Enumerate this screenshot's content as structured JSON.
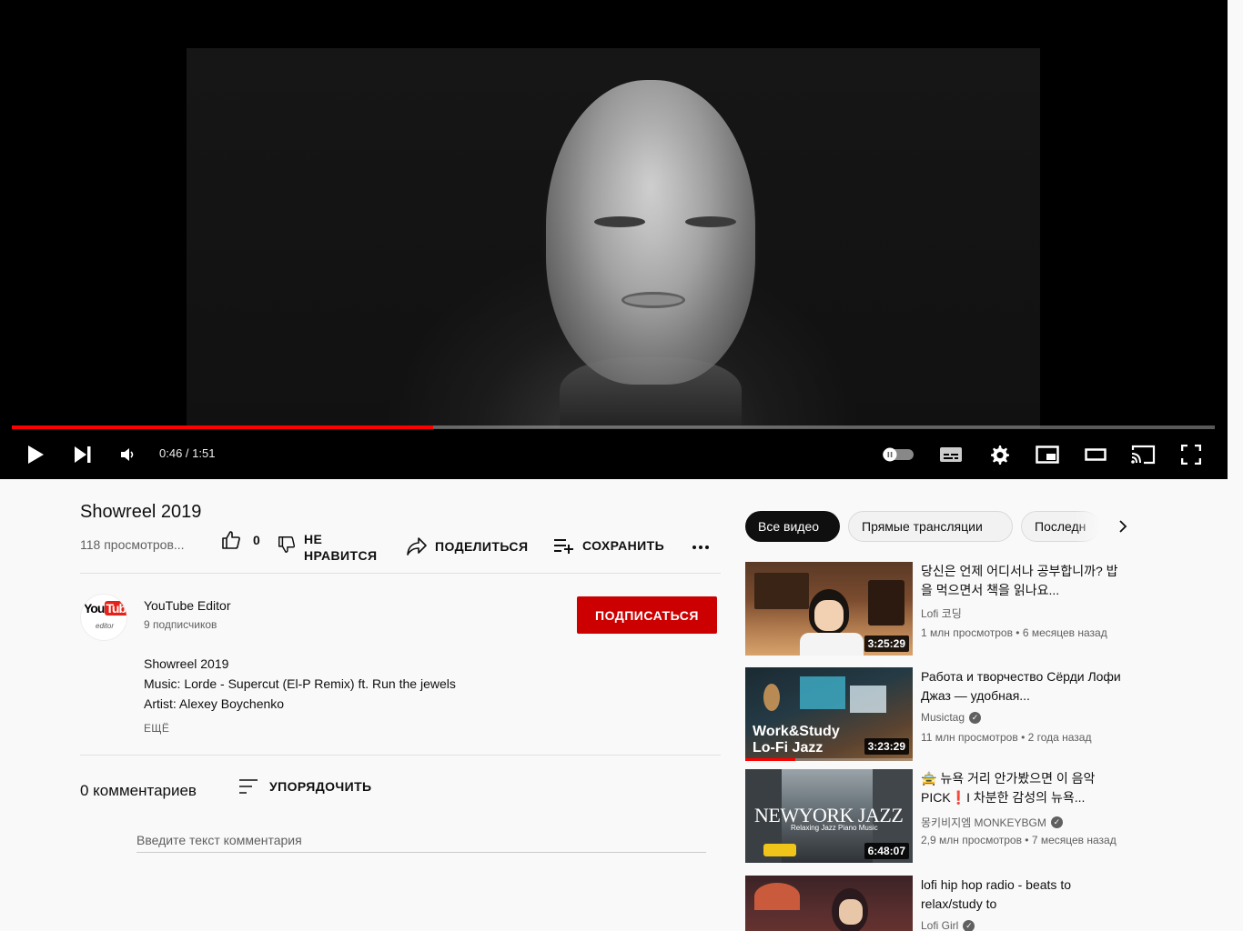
{
  "player": {
    "time": "0:46 / 1:51",
    "progress_fraction": 0.35
  },
  "video": {
    "title": "Showreel 2019",
    "views": "118 просмотров...",
    "like_count": "0",
    "dislike_label_1": "НЕ",
    "dislike_label_2": "НРАВИТСЯ",
    "share_label": "ПОДЕЛИТЬСЯ",
    "save_label": "СОХРАНИТЬ"
  },
  "channel": {
    "name": "YouTube Editor",
    "subscribers": "9 подписчиков",
    "subscribe_label": "ПОДПИСАТЬСЯ",
    "avatar_text_1": "You",
    "avatar_text_2": "Tube",
    "avatar_text_3": "editor"
  },
  "description": {
    "line1": "Showreel 2019",
    "line2": "Music: Lorde - Supercut (El-P Remix) ft. Run the jewels",
    "line3": "Artist: Alexey Boychenko",
    "more_label": "ЕЩЁ"
  },
  "comments": {
    "count_label": "0 комментариев",
    "sort_label": "УПОРЯДОЧИТЬ",
    "input_placeholder": "Введите текст комментария"
  },
  "chips": [
    {
      "label": "Все видео"
    },
    {
      "label": "Прямые трансляции"
    },
    {
      "label": "Последн"
    }
  ],
  "recommendations": [
    {
      "title": "당신은 언제 어디서나 공부합니까? 밥을 먹으면서 책을 읽나요...",
      "channel": "Lofi 코딩",
      "verified": false,
      "meta": "1 млн просмотров • 6 месяцев назад",
      "duration": "3:25:29"
    },
    {
      "title": "Работа и творчество Сёрди Лофи Джаз — удобная...",
      "channel": "Musictag",
      "verified": true,
      "meta": "11 млн просмотров • 2 года назад",
      "duration": "3:23:29",
      "thumb_text_1": "Work&Study",
      "thumb_text_2": "Lo-Fi Jazz",
      "thumb_progress": 0.3
    },
    {
      "title": "🚖 뉴욕 거리 안가봤으면 이 음악 PICK❗I 차분한 감성의 뉴욕...",
      "channel": "몽키비지엠 MONKEYBGM",
      "verified": true,
      "meta": "2,9 млн просмотров • 7 месяцев назад",
      "duration": "6:48:07",
      "thumb_text_1": "NEWYORK JAZZ",
      "thumb_text_2": "Relaxing Jazz Piano Music"
    },
    {
      "title": "lofi hip hop radio - beats to relax/study to",
      "channel": "Lofi Girl",
      "verified": true,
      "meta": "",
      "duration": ""
    }
  ],
  "colors": {
    "accent_red": "#ff0000",
    "subscribe_red": "#cc0000",
    "page_bg": "#f9f9f9"
  },
  "icons": [
    "play-icon",
    "next-icon",
    "volume-icon",
    "autoplay-toggle-icon",
    "subtitles-icon",
    "settings-icon",
    "miniplayer-icon",
    "theater-icon",
    "cast-icon",
    "fullscreen-icon",
    "like-icon",
    "dislike-icon",
    "share-icon",
    "save-icon",
    "more-icon",
    "sort-icon",
    "chevron-right-icon",
    "verified-icon"
  ]
}
